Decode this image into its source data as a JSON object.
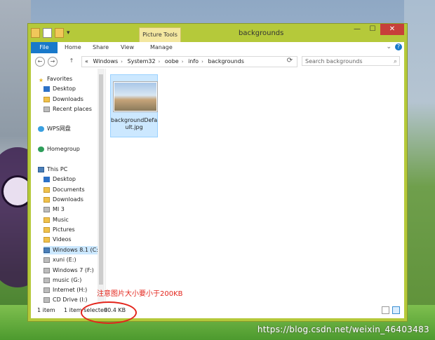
{
  "window": {
    "title": "backgrounds",
    "context_tab": "Picture Tools",
    "controls": {
      "minimize": "—",
      "maximize": "☐",
      "close": "✕"
    }
  },
  "ribbon": {
    "tabs": [
      "File",
      "Home",
      "Share",
      "View",
      "Manage"
    ],
    "expand_glyph": "⌄",
    "help_glyph": "?"
  },
  "address": {
    "back": "←",
    "forward": "→",
    "up": "↑",
    "crumbs": [
      "«",
      "Windows",
      "System32",
      "oobe",
      "info",
      "backgrounds"
    ],
    "refresh": "⟳",
    "search_placeholder": "Search backgrounds"
  },
  "nav": {
    "favorites_header": "Favorites",
    "favorites": [
      "Desktop",
      "Downloads",
      "Recent places"
    ],
    "wps": "WPS网盘",
    "homegroup": "Homegroup",
    "thispc_header": "This PC",
    "thispc": [
      "Desktop",
      "Documents",
      "Downloads",
      "MI 3",
      "Music",
      "Pictures",
      "Videos"
    ],
    "drives": [
      "Windows 8.1 (C:",
      "xuni (E:)",
      "Windows 7 (F:)",
      "music (G:)",
      "Internet (H:)",
      "CD Drive (I:)"
    ]
  },
  "content": {
    "files": [
      {
        "name": "backgroundDefault.jpg",
        "name_line1": "backgroundDefa",
        "name_line2": "ult.jpg"
      }
    ]
  },
  "status": {
    "items": "1 item",
    "selected": "1 item selected",
    "size": "90.4 KB"
  },
  "annotation": {
    "text": "注意图片大小要小于200KB",
    "color": "#e3241b"
  },
  "watermark": "https://blog.csdn.net/weixin_46403483"
}
